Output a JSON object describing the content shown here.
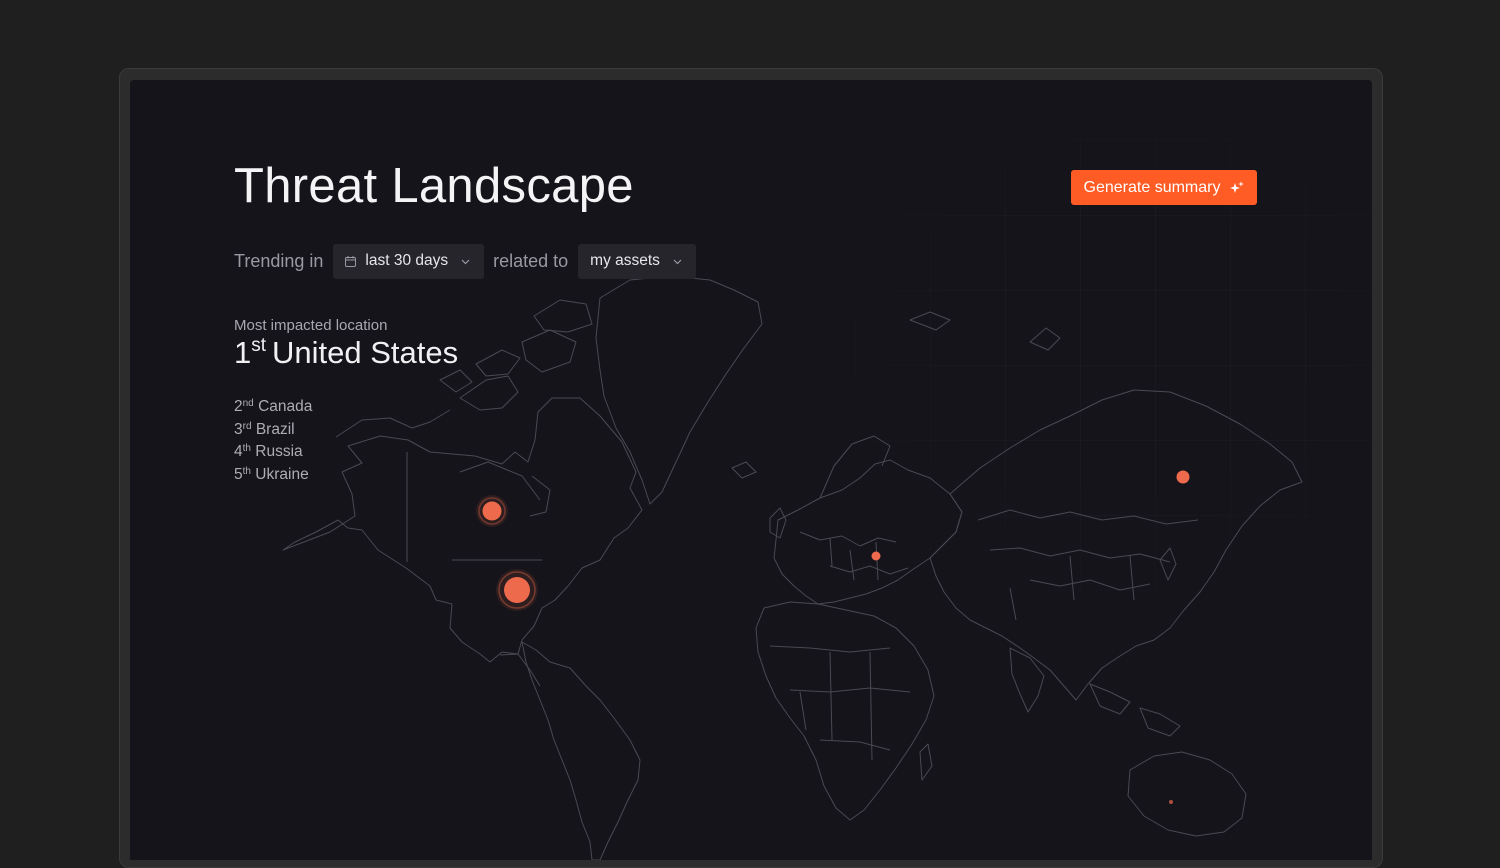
{
  "page": {
    "title": "Threat Landscape",
    "generate_button_label": "Generate summary"
  },
  "filters": {
    "prefix": "Trending in",
    "period": "last 30 days",
    "connector": "related to",
    "scope": "my assets"
  },
  "top_location": {
    "caption": "Most impacted location",
    "rank_number": "1",
    "rank_suffix": "st",
    "name": "United States"
  },
  "ranking": [
    {
      "number": "2",
      "suffix": "nd",
      "name": "Canada"
    },
    {
      "number": "3",
      "suffix": "rd",
      "name": "Brazil"
    },
    {
      "number": "4",
      "suffix": "th",
      "name": "Russia"
    },
    {
      "number": "5",
      "suffix": "th",
      "name": "Ukraine"
    }
  ],
  "icons": {
    "generate": "sparkle-icon",
    "period": "calendar-icon",
    "dropdown": "chevron-down-icon"
  },
  "colors": {
    "accent": "#ff5c25",
    "marker": "#ee6a4c",
    "background": "#15141a"
  }
}
